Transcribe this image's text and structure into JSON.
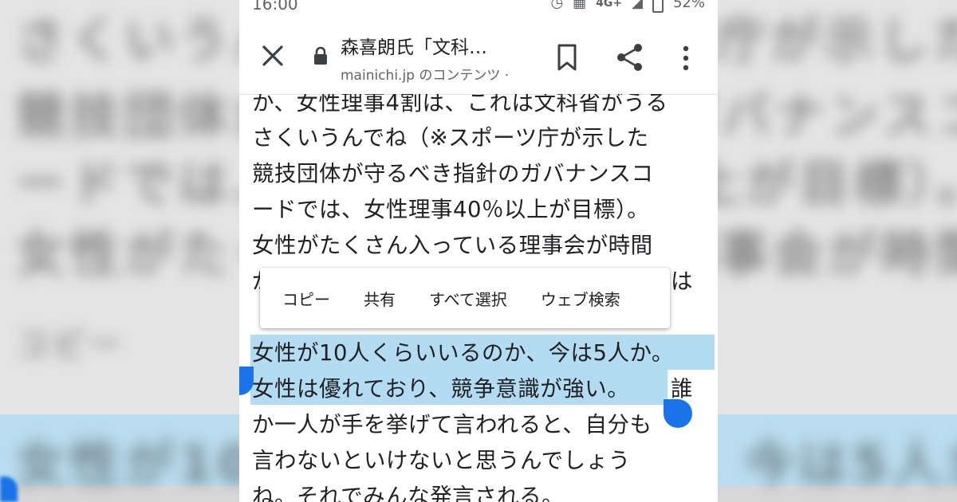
{
  "status_bar": {
    "time": "16:00",
    "network": "4G+",
    "battery": "52%"
  },
  "toolbar": {
    "title": "森喜朗氏「文科…",
    "url": "mainichi.jp のコンテンツ ·",
    "close_icon": "close-icon",
    "lock_icon": "lock-icon",
    "bookmark_icon": "bookmark-icon",
    "share_icon": "share-icon",
    "more_icon": "more-vert-icon"
  },
  "article": {
    "lines": [
      "か、女性理事4割は、これは文科省がうる",
      "さくいうんでね（※スポーツ庁が示した",
      "競技団体が守るべき指針のガバナンスコ",
      "ードでは、女性理事40％以上が目標）。",
      "女性がたくさん入っている理事会が時間",
      "が",
      "は",
      "。",
      "女性が10人くらいいるのか、今は5人か。",
      "女性は優れており、競争意識が強い。",
      "誰",
      "か一人が手を挙げて言われると、自分も",
      "言わないといけないと思うんでしょう",
      "ね。それでみんな発言される。"
    ]
  },
  "selection_menu": {
    "items": [
      "コピー",
      "共有",
      "すべて選択",
      "ウェブ検索"
    ]
  },
  "colors": {
    "highlight": "#b3dcf2",
    "handle": "#1a73e8"
  }
}
